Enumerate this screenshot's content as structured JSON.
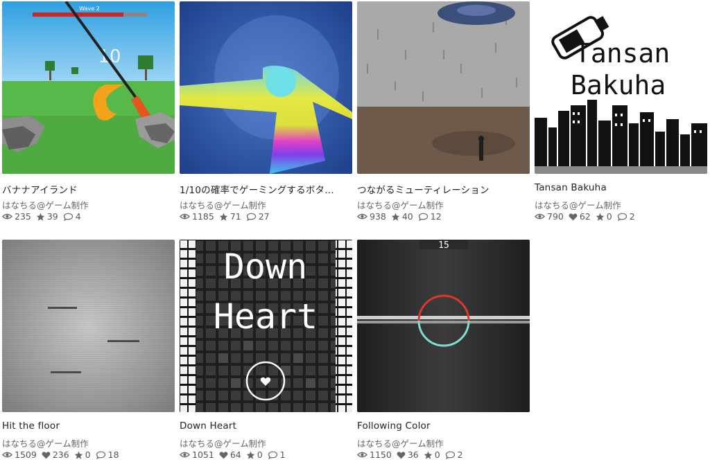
{
  "games": [
    {
      "title": "バナナアイランド",
      "author": "はなちる@ゲーム制作",
      "views": "235",
      "likes": null,
      "stars": "39",
      "comments": "4",
      "thumb": {
        "hud": "Wave 2",
        "score": "10"
      }
    },
    {
      "title": "1/10の確率でゲーミングするボタ…",
      "author": "はなちる@ゲーム制作",
      "views": "1185",
      "likes": null,
      "stars": "71",
      "comments": "27"
    },
    {
      "title": "つながるミューティレーション",
      "author": "はなちる@ゲーム制作",
      "views": "938",
      "likes": null,
      "stars": "40",
      "comments": "12"
    },
    {
      "title": "Tansan Bakuha",
      "author": "はなちる@ゲーム制作",
      "views": "790",
      "likes": "62",
      "stars": "0",
      "comments": "2",
      "thumb": {
        "line1": "Tansan",
        "line2": "Bakuha"
      }
    },
    {
      "title": "Hit the floor",
      "author": "はなちる@ゲーム制作",
      "views": "1509",
      "likes": "236",
      "stars": "0",
      "comments": "18"
    },
    {
      "title": "Down Heart",
      "author": "はなちる@ゲーム制作",
      "views": "1051",
      "likes": "64",
      "stars": "0",
      "comments": "1",
      "thumb": {
        "line1": "Down",
        "line2": "Heart"
      }
    },
    {
      "title": "Following Color",
      "author": "はなちる@ゲーム制作",
      "views": "1150",
      "likes": "36",
      "stars": "0",
      "comments": "2",
      "thumb": {
        "score": "15"
      }
    }
  ],
  "colors": {
    "banana_grass": "#56b94a",
    "banana_sky": "#2f9fe0",
    "ring_red": "#e0352b",
    "ring_cyan": "#7ee0d0"
  }
}
